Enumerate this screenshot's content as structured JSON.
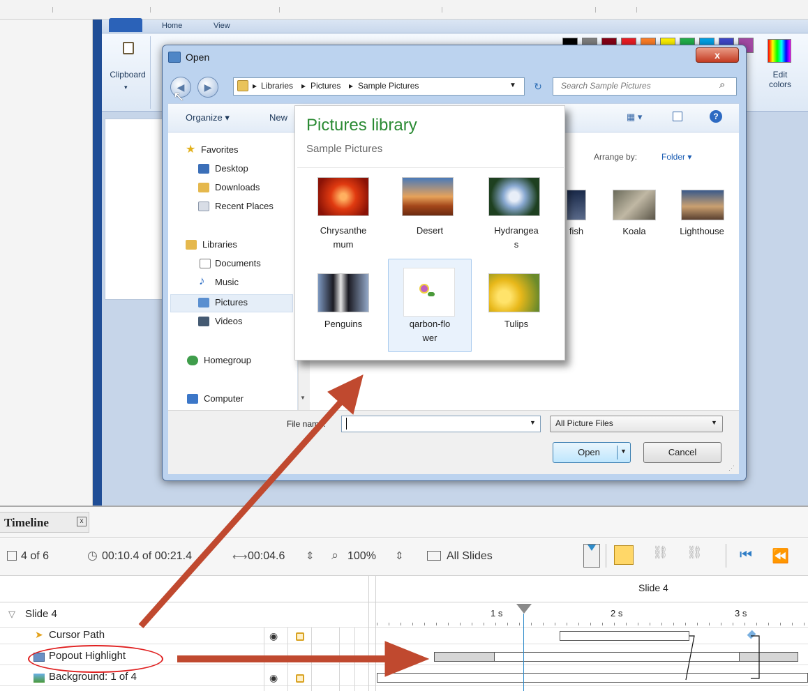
{
  "paint": {
    "tabs": [
      "Home",
      "View"
    ],
    "clipboard_label": "Clipboard",
    "edit_colors_label": "Edit colors",
    "palette": [
      "#000000",
      "#7f7f7f",
      "#880015",
      "#ed1c24",
      "#ff7f27",
      "#fff200",
      "#22b14c",
      "#00a2e8",
      "#3f48cc",
      "#a349a4"
    ]
  },
  "dialog": {
    "title": "Open",
    "close_label": "x",
    "breadcrumb": [
      "Libraries",
      "Pictures",
      "Sample Pictures"
    ],
    "search_placeholder": "Search Sample Pictures",
    "organize_label": "Organize ▾",
    "new_folder_label": "New",
    "arrange_label": "Arrange by:",
    "arrange_value": "Folder ▾",
    "nav": {
      "favorites": "Favorites",
      "desktop": "Desktop",
      "downloads": "Downloads",
      "recent": "Recent Places",
      "libraries": "Libraries",
      "documents": "Documents",
      "music": "Music",
      "pictures": "Pictures",
      "videos": "Videos",
      "homegroup": "Homegroup",
      "computer": "Computer"
    },
    "bg_items": [
      "fish",
      "Koala",
      "Lighthouse"
    ],
    "file_name_label": "File name:",
    "file_name_value": "",
    "file_type": "All Picture Files",
    "open_label": "Open",
    "cancel_label": "Cancel"
  },
  "popout": {
    "title": "Pictures library",
    "subtitle": "Sample Pictures",
    "items": [
      {
        "line1": "Chrysanthe",
        "line2": "mum"
      },
      {
        "line1": "Desert",
        "line2": ""
      },
      {
        "line1": "Hydrangea",
        "line2": "s"
      },
      {
        "line1": "Penguins",
        "line2": ""
      },
      {
        "line1": "qarbon-flo",
        "line2": "wer"
      },
      {
        "line1": "Tulips",
        "line2": ""
      }
    ]
  },
  "timeline": {
    "title": "Timeline",
    "close": "x",
    "slide_count": "4 of 6",
    "time": "00:10.4 of 00:21.4",
    "duration": "00:04.6",
    "zoom": "100%",
    "all_slides": "All Slides",
    "slide_header": "Slide 4",
    "ruler": [
      "1 s",
      "2 s",
      "3 s"
    ],
    "rows": {
      "slide": "Slide 4",
      "cursor": "Cursor Path",
      "popout": "Popout Highlight",
      "background": "Background: 1 of 4"
    }
  },
  "colors": {
    "annotation_arrow": "#c0492f",
    "annotation_ellipse": "#e02020",
    "popout_title": "#2a8a33",
    "playhead": "#2e8bc9"
  }
}
